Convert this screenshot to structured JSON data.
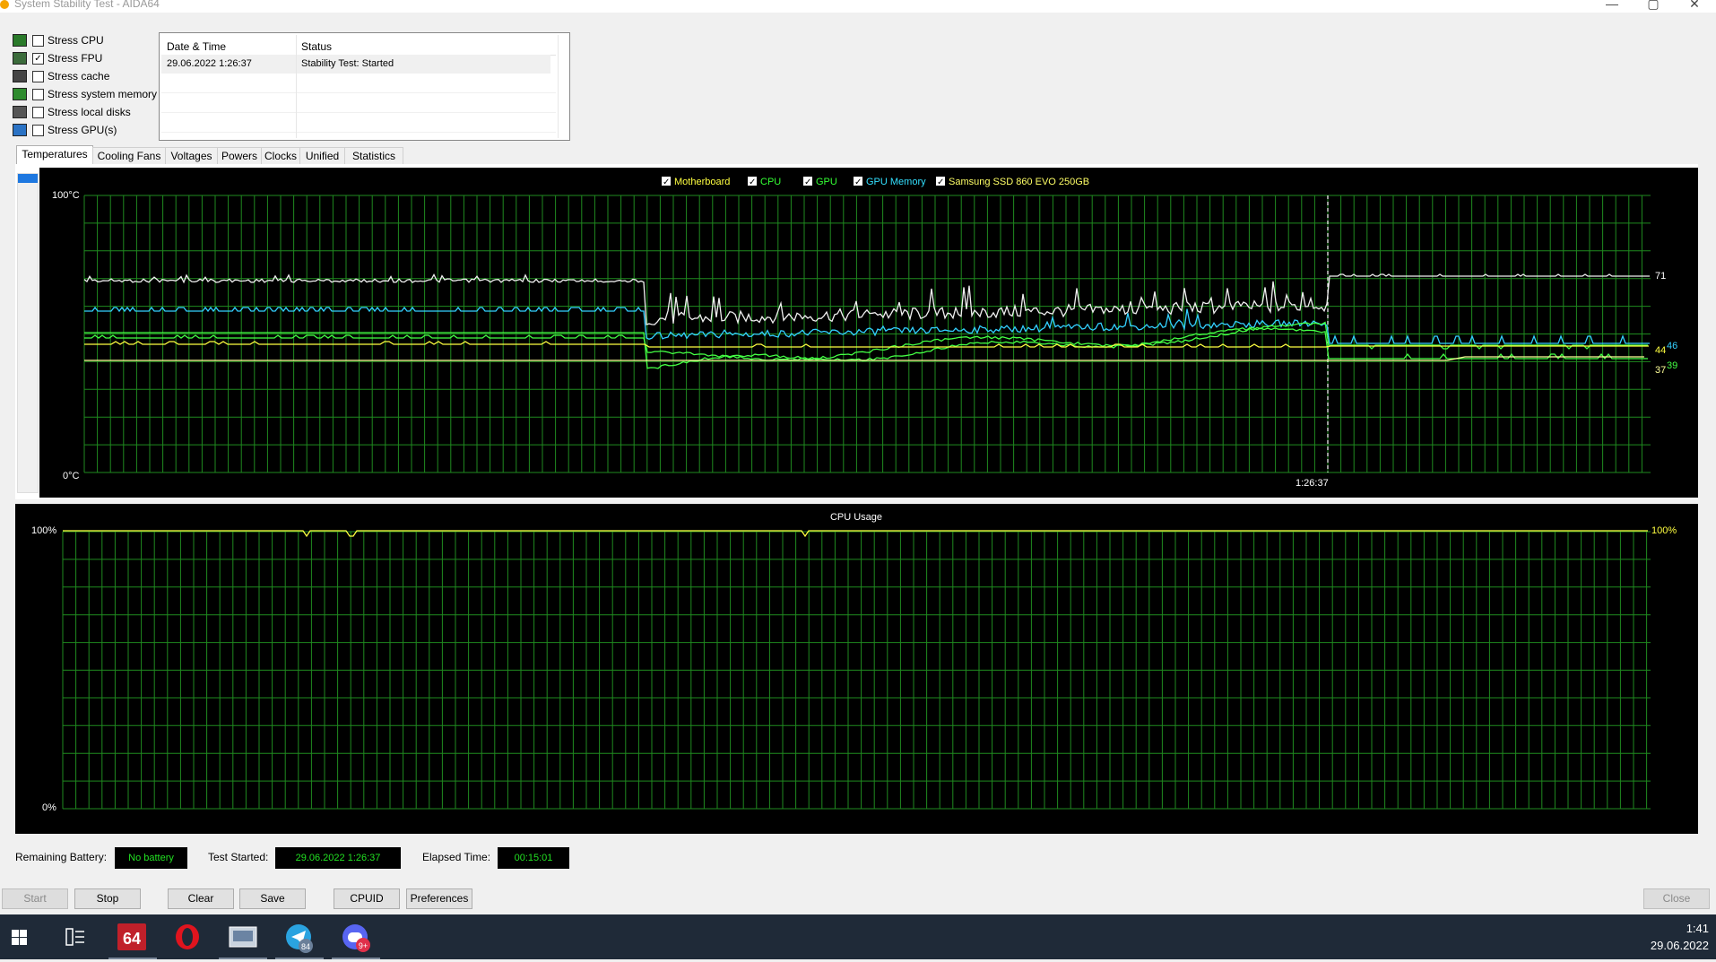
{
  "window": {
    "title": "System Stability Test - AIDA64"
  },
  "stress_options": [
    {
      "label": "Stress CPU",
      "checked": false,
      "icon": "cpu-chip-icon"
    },
    {
      "label": "Stress FPU",
      "checked": true,
      "icon": "fpu-chip-icon"
    },
    {
      "label": "Stress cache",
      "checked": false,
      "icon": "cache-icon"
    },
    {
      "label": "Stress system memory",
      "checked": false,
      "icon": "memory-stick-icon"
    },
    {
      "label": "Stress local disks",
      "checked": false,
      "icon": "hard-disk-icon"
    },
    {
      "label": "Stress GPU(s)",
      "checked": false,
      "icon": "gpu-monitor-icon"
    }
  ],
  "status_table": {
    "headers": [
      "Date & Time",
      "Status"
    ],
    "rows": [
      {
        "datetime": "29.06.2022 1:26:37",
        "status": "Stability Test: Started"
      }
    ]
  },
  "tabs": [
    "Temperatures",
    "Cooling Fans",
    "Voltages",
    "Powers",
    "Clocks",
    "Unified",
    "Statistics"
  ],
  "active_tab": "Temperatures",
  "temperature_chart": {
    "legend": [
      {
        "label": "Motherboard",
        "color": "#ffff40",
        "checked": true
      },
      {
        "label": "CPU",
        "color": "#33ff33",
        "checked": true
      },
      {
        "label": "GPU",
        "color": "#33ff33",
        "checked": true
      },
      {
        "label": "GPU Memory",
        "color": "#33e0ff",
        "checked": true
      },
      {
        "label": "Samsung SSD 860 EVO 250GB",
        "color": "#ffff66",
        "checked": true
      }
    ],
    "y_max_label": "100°C",
    "y_min_label": "0°C",
    "marker_time": "1:26:37",
    "end_values": [
      "71",
      "46",
      "44",
      "39",
      "37"
    ],
    "series_colors": {
      "white": "#f0f0f0",
      "cyan": "#33d0ff",
      "green": "#44ff44",
      "yellow": "#ffff40",
      "ssd": "#ffff99"
    }
  },
  "cpu_chart": {
    "title": "CPU Usage",
    "y_max_label": "100%",
    "y_min_label": "0%",
    "current_value": "100%"
  },
  "info": {
    "battery_label": "Remaining Battery:",
    "battery_value": "No battery",
    "started_label": "Test Started:",
    "started_value": "29.06.2022 1:26:37",
    "elapsed_label": "Elapsed Time:",
    "elapsed_value": "00:15:01"
  },
  "buttons": {
    "start": "Start",
    "stop": "Stop",
    "clear": "Clear",
    "save": "Save",
    "cpuid": "CPUID",
    "preferences": "Preferences",
    "close": "Close"
  },
  "taskbar": {
    "items": [
      {
        "name": "start-icon"
      },
      {
        "name": "task-view-icon"
      },
      {
        "name": "aida64-icon",
        "label": "64"
      },
      {
        "name": "opera-icon"
      },
      {
        "name": "explorer-icon"
      },
      {
        "name": "telegram-icon",
        "badge": "84"
      },
      {
        "name": "discord-icon",
        "badge": "9+"
      }
    ],
    "time": "1:41",
    "date": "29.06.2022"
  }
}
